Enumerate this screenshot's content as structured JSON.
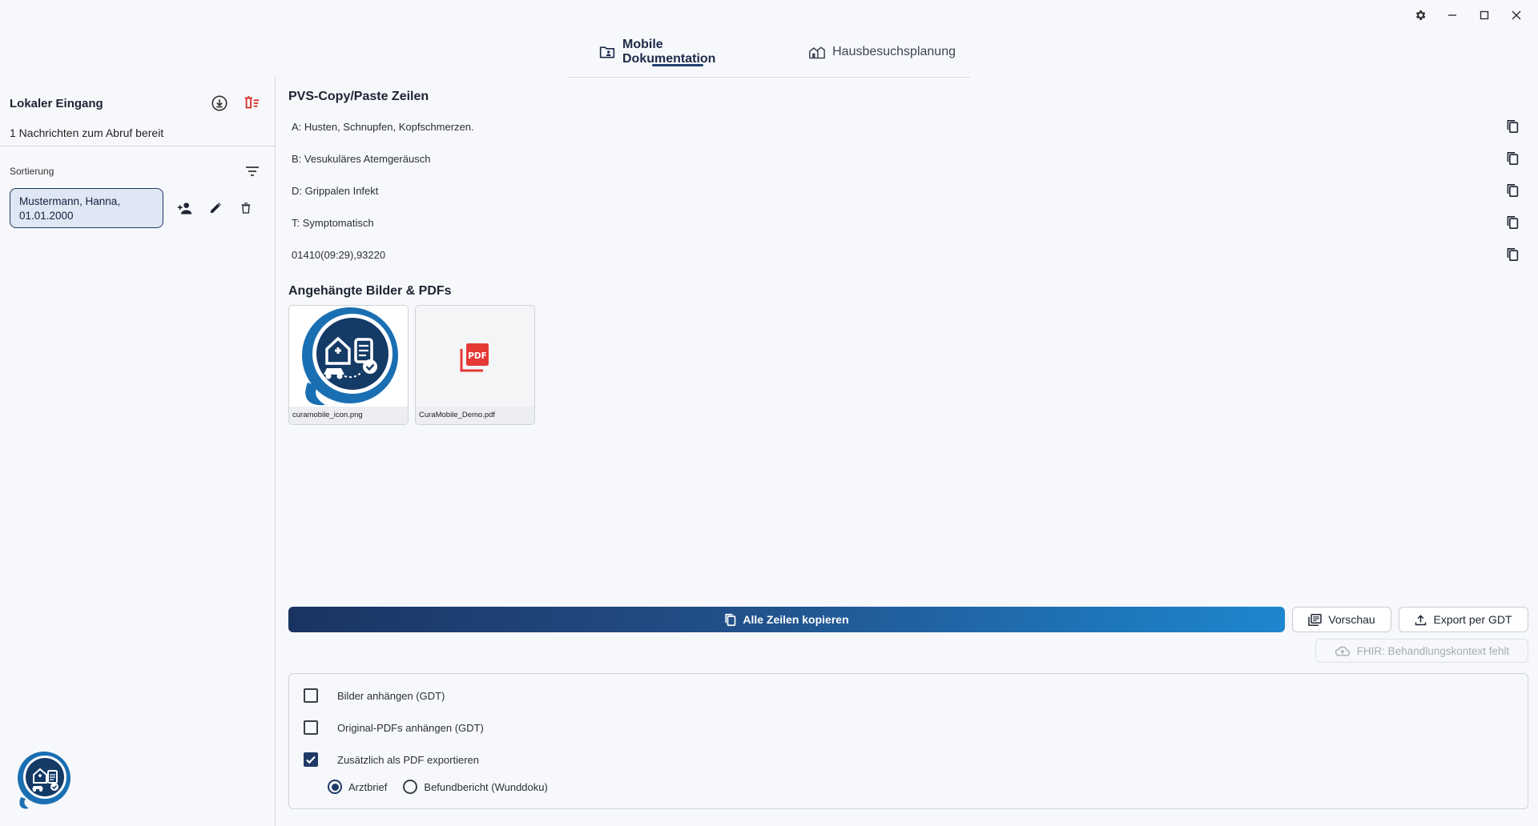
{
  "tabs": [
    {
      "label": "Mobile Dokumentation",
      "active": true
    },
    {
      "label": "Hausbesuchsplanung",
      "active": false
    }
  ],
  "sidebar": {
    "title": "Lokaler Eingang",
    "message": "1 Nachrichten zum Abruf bereit",
    "sort_label": "Sortierung",
    "patient": {
      "name": "Mustermann, Hanna,",
      "dob": "01.01.2000"
    }
  },
  "pvs": {
    "title": "PVS-Copy/Paste Zeilen",
    "lines": [
      "A: Husten, Schnupfen, Kopfschmerzen.",
      "B: Vesukuläres Atemgeräusch",
      "D: Grippalen Infekt",
      "T: Symptomatisch",
      "01410(09:29),93220"
    ]
  },
  "attachments": {
    "title": "Angehängte Bilder & PDFs",
    "files": [
      {
        "name": "curamobile_icon.png",
        "type": "image"
      },
      {
        "name": "CuraMobile_Demo.pdf",
        "type": "pdf"
      }
    ]
  },
  "actions": {
    "copy_all": "Alle Zeilen kopieren",
    "preview": "Vorschau",
    "export_gdt": "Export per GDT",
    "fhir": "FHIR: Behandlungskontext fehlt"
  },
  "options": {
    "attach_images": {
      "label": "Bilder anhängen (GDT)",
      "checked": false
    },
    "attach_pdfs": {
      "label": "Original-PDFs anhängen (GDT)",
      "checked": false
    },
    "export_pdf": {
      "label": "Zusätzlich als PDF exportieren",
      "checked": true
    },
    "pdf_types": [
      {
        "label": "Arztbrief",
        "selected": true
      },
      {
        "label": "Befundbericht (Wunddoku)",
        "selected": false
      }
    ]
  },
  "colors": {
    "brand": "#1f3a66",
    "accent": "#1d87cf",
    "danger": "#d93025"
  }
}
